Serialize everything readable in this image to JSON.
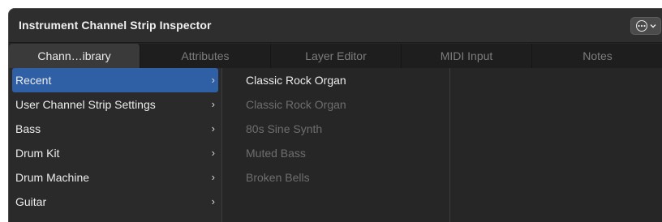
{
  "window": {
    "title": "Instrument Channel Strip Inspector"
  },
  "tabs": [
    {
      "label": "Chann…ibrary"
    },
    {
      "label": "Attributes"
    },
    {
      "label": "Layer Editor"
    },
    {
      "label": "MIDI Input"
    },
    {
      "label": "Notes"
    }
  ],
  "categories": [
    {
      "label": "Recent",
      "arrow": "›"
    },
    {
      "label": "User Channel Strip Settings",
      "arrow": "›"
    },
    {
      "label": "Bass",
      "arrow": "›"
    },
    {
      "label": "Drum Kit",
      "arrow": "›"
    },
    {
      "label": "Drum Machine",
      "arrow": "›"
    },
    {
      "label": "Guitar",
      "arrow": "›"
    }
  ],
  "patches": [
    {
      "label": "Classic Rock Organ"
    },
    {
      "label": "Classic Rock Organ"
    },
    {
      "label": "80s Sine Synth"
    },
    {
      "label": "Muted Bass"
    },
    {
      "label": "Broken Bells"
    }
  ],
  "options_button": {
    "chevron": "⌄",
    "dots": "···"
  }
}
